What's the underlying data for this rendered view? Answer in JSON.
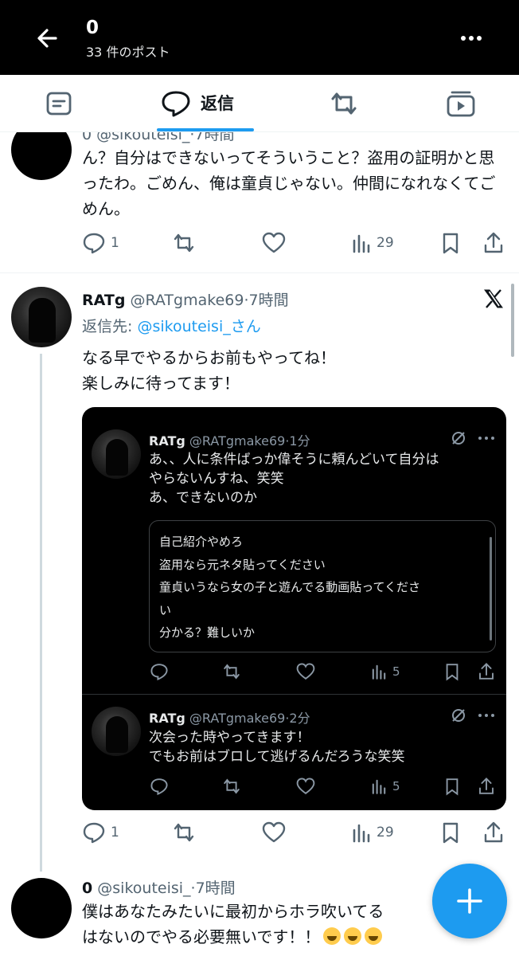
{
  "header": {
    "title": "0",
    "subtitle": "33 件のポスト",
    "back_icon": "arrow-left-icon",
    "more_icon": "more-vertical-icon"
  },
  "tabs": [
    {
      "name": "posts",
      "icon": "list-icon",
      "label": ""
    },
    {
      "name": "replies",
      "icon": "reply-bubble-icon",
      "label": "返信",
      "selected": true
    },
    {
      "name": "reposts",
      "icon": "repost-icon",
      "label": ""
    },
    {
      "name": "media",
      "icon": "media-icon",
      "label": ""
    }
  ],
  "accent_color": "#1d9bf0",
  "tweet1": {
    "meta_partial": "0 @sikouteisi_·7時間",
    "text": "ん？自分はできないってそういうこと？盗用の証明かと思ったわ。ごめん、俺は童貞じゃない。仲間になれなくてごめん。",
    "replies": "1",
    "reposts": "",
    "likes": "",
    "views": "29"
  },
  "tweet2": {
    "name": "RATg",
    "handle": "@RATgmake69",
    "time": "·7時間",
    "reply_to_label": "返信先: ",
    "reply_to_user": "@sikouteisi_さん",
    "text_line1": "なる早でやるからお前もやってね！",
    "text_line2": "楽しみに待ってます！",
    "replies": "1",
    "views": "29",
    "card": {
      "item1": {
        "name": "RATg",
        "handle": "@RATgmake69",
        "time": "·1分",
        "line1": "あ、、人に条件ばっか偉そうに頼んどいて自分は",
        "line2": "やらないんすね、笑笑",
        "line3": "あ、できないのか",
        "inner_line1": "自己紹介やめろ",
        "inner_line2": "盗用なら元ネタ貼ってください",
        "inner_line3": "童貞いうなら女の子と遊んでる動画貼ってくださ",
        "inner_line4": "い",
        "inner_line5": "分かる？難しいか",
        "views": "5"
      },
      "item2": {
        "name": "RATg",
        "handle": "@RATgmake69",
        "time": "·2分",
        "line1": "次会った時やってきます！",
        "line2": "でもお前はブロして逃げるんだろうな笑笑",
        "views": "5"
      }
    }
  },
  "tweet3": {
    "name": "0",
    "handle": "@sikouteisi_",
    "time": "·7時間",
    "line1": "僕はあなたみたいに最初からホラ吹いてる",
    "line2": "はないのでやる必要無いです！！"
  },
  "fab_icon": "plus-icon"
}
